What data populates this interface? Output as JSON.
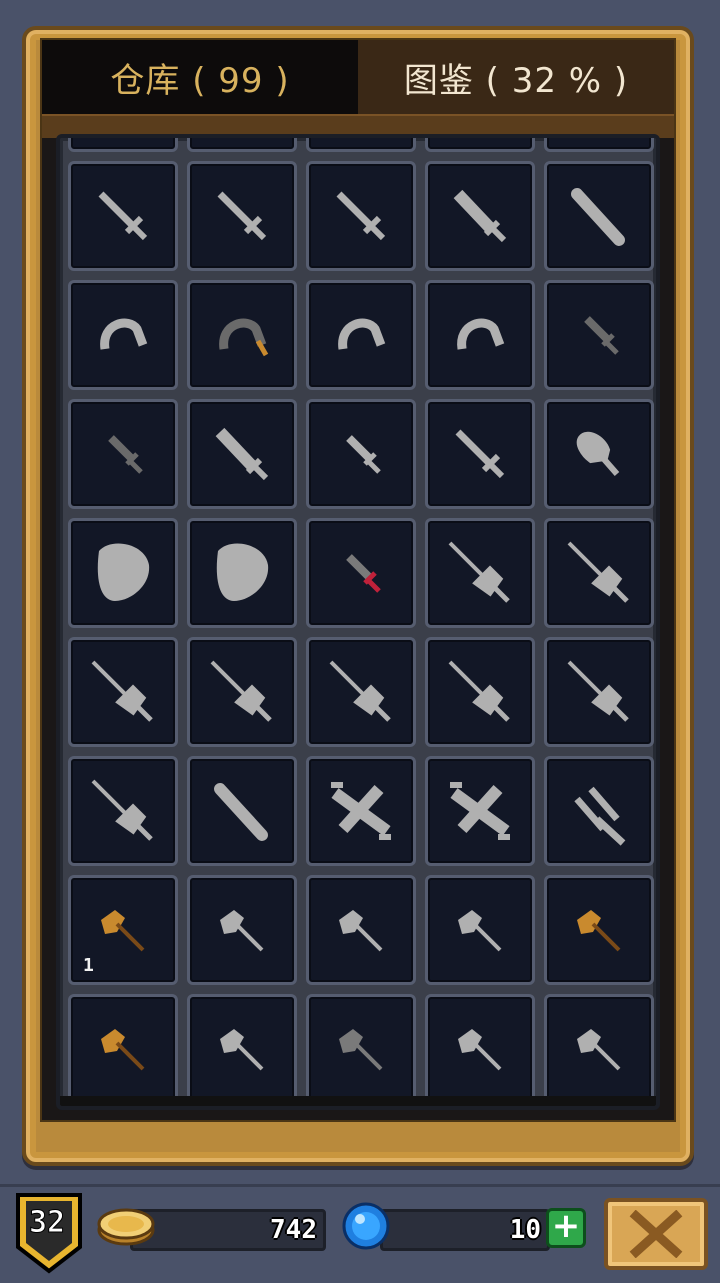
{
  "tabs": [
    {
      "label": "仓库 ( 99 )",
      "active": true
    },
    {
      "label": "图鉴 ( 32 % )",
      "active": false
    }
  ],
  "items": [
    {
      "icon": "bronze-sword-icon",
      "color": "#c98a2e"
    },
    {
      "icon": "gray-sword-icon",
      "color": "#b0b0b0"
    },
    {
      "icon": "silver-sword-icon",
      "color": "#c98a2e"
    },
    {
      "icon": "great-sword-icon",
      "color": "#b0b0b0"
    },
    {
      "icon": "gray-sword-icon",
      "color": "#b0b0b0"
    },
    {
      "icon": "gray-sword-icon",
      "color": "#b0b0b0"
    },
    {
      "icon": "gray-sword-icon",
      "color": "#b0b0b0"
    },
    {
      "icon": "gray-sword-icon",
      "color": "#b0b0b0"
    },
    {
      "icon": "broad-sword-icon",
      "color": "#b0b0b0"
    },
    {
      "icon": "club-icon",
      "color": "#b0b0b0"
    },
    {
      "icon": "sickle-icon",
      "color": "#b0b0b0"
    },
    {
      "icon": "dark-sickle-icon",
      "color": "#6a6a6a"
    },
    {
      "icon": "sickle-icon",
      "color": "#b0b0b0"
    },
    {
      "icon": "sickle-icon",
      "color": "#b0b0b0"
    },
    {
      "icon": "dark-dagger-icon",
      "color": "#6a6a6a"
    },
    {
      "icon": "dark-dagger-icon",
      "color": "#6a6a6a"
    },
    {
      "icon": "broad-sword-icon",
      "color": "#b0b0b0"
    },
    {
      "icon": "dagger-icon",
      "color": "#b0b0b0"
    },
    {
      "icon": "gray-sword-icon",
      "color": "#b0b0b0"
    },
    {
      "icon": "paddle-icon",
      "color": "#b0b0b0"
    },
    {
      "icon": "shield-icon",
      "color": "#b0b0b0"
    },
    {
      "icon": "shield-icon",
      "color": "#b0b0b0"
    },
    {
      "icon": "red-dagger-icon",
      "color": "#7a7a7a"
    },
    {
      "icon": "rapier-icon",
      "color": "#b0b0b0"
    },
    {
      "icon": "rapier-icon",
      "color": "#b0b0b0"
    },
    {
      "icon": "rapier-icon",
      "color": "#b0b0b0"
    },
    {
      "icon": "rapier-icon",
      "color": "#b0b0b0"
    },
    {
      "icon": "rapier-icon",
      "color": "#b0b0b0"
    },
    {
      "icon": "rapier-icon",
      "color": "#b0b0b0"
    },
    {
      "icon": "rapier-icon",
      "color": "#b0b0b0"
    },
    {
      "icon": "rapier-icon",
      "color": "#b0b0b0"
    },
    {
      "icon": "club-icon",
      "color": "#b0b0b0"
    },
    {
      "icon": "cross-blade-icon",
      "color": "#b0b0b0"
    },
    {
      "icon": "cross-blade-icon",
      "color": "#b0b0b0"
    },
    {
      "icon": "trident-icon",
      "color": "#b0b0b0"
    },
    {
      "icon": "bronze-axe-icon",
      "color": "#c98a2e",
      "count": "1"
    },
    {
      "icon": "axe-icon",
      "color": "#b0b0b0"
    },
    {
      "icon": "axe-icon",
      "color": "#b0b0b0"
    },
    {
      "icon": "axe-icon",
      "color": "#b0b0b0"
    },
    {
      "icon": "bronze-axe-icon",
      "color": "#c98a2e"
    },
    {
      "icon": "bronze-axe-icon",
      "color": "#c98a2e"
    },
    {
      "icon": "axe-icon",
      "color": "#b0b0b0"
    },
    {
      "icon": "dark-axe-icon",
      "color": "#7a7a7a"
    },
    {
      "icon": "axe-icon",
      "color": "#b0b0b0"
    },
    {
      "icon": "axe-icon",
      "color": "#b0b0b0"
    }
  ],
  "status": {
    "level": "32",
    "gold": "742",
    "gems": "10",
    "plus_label": "+"
  },
  "colors": {
    "accent_gold": "#d8b25e",
    "frame_wood": "#b98a3c",
    "cell_bg": "#121726",
    "plus_green": "#2fa84a"
  }
}
